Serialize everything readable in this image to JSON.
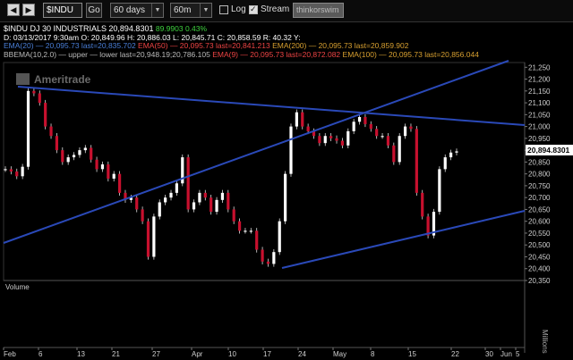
{
  "toolbar": {
    "symbol": "$INDU",
    "go_label": "Go",
    "period_value": "60 days",
    "interval_value": "60m",
    "log_label": "Log",
    "log_checked": false,
    "stream_label": "Stream",
    "stream_checked": true,
    "brand_logo_text": "thinkorswim"
  },
  "header": {
    "line1_name": "$INDU DJ 30 INDUSTRIALS",
    "line1_price": "20,894.8301",
    "line1_change": "89.9903",
    "line1_pct": "0.43%",
    "line2": "D: 03/13/2017    9:30am  O: 20,849.96  H: 20,886.03  L: 20,845.71  C: 20,858.59  R: 40.32    Y:",
    "ema_line": {
      "ema20": "EMA(20) — 20,095.73 last=20,835.702",
      "ema50": "EMA(50) — 20,095.73 last=20,841.213",
      "ema200": "EMA(200) — 20,095.73 last=20,859.902"
    },
    "bb_line": {
      "bb": "BBEMA(10,2.0) — upper — lower last=20,948.19;20,786.105",
      "ema9": "EMA(9) — 20,095.73 last=20,872.082",
      "ema100": "EMA(100) — 20,095.73 last=20,856.044"
    }
  },
  "watermark": "Ameritrade",
  "price_axis": {
    "labels": [
      "21,250",
      "21,200",
      "21,150",
      "21,100",
      "21,050",
      "21,000",
      "20,950",
      "20,900",
      "20,850",
      "20,800",
      "20,750",
      "20,700",
      "20,650",
      "20,600",
      "20,550",
      "20,500",
      "20,450",
      "20,400",
      "20,350"
    ],
    "last_price_label": "20,894.8301"
  },
  "volume_panel": {
    "label": "Volume",
    "unit_label": "Millions"
  },
  "x_axis": {
    "labels": [
      "Feb",
      "6",
      "13",
      "21",
      "27",
      "Apr",
      "10",
      "17",
      "24",
      "May",
      "8",
      "15",
      "22",
      "30",
      "Jun",
      "5"
    ]
  },
  "colors": {
    "background": "#000000",
    "trendline": "#2a49b8",
    "candle": "#ffffff",
    "candle_down": "#c8102e",
    "gain": "#3fd13f",
    "ema20": "#4a7fd8",
    "ema50": "#d33333",
    "ema200": "#d8a030"
  },
  "chart_data": {
    "type": "candlestick",
    "title": "$INDU DJ 30 INDUSTRIALS",
    "interval": "60m",
    "period": "60 days",
    "ylim": [
      20350,
      21270
    ],
    "last_price": 20894.8301,
    "x_labels": [
      "Feb",
      "6",
      "13",
      "21",
      "27",
      "Apr",
      "10",
      "17",
      "24",
      "May",
      "8",
      "15",
      "22",
      "30",
      "Jun",
      "5"
    ],
    "series": [
      {
        "name": "$INDU",
        "values": [
          20820,
          20810,
          20790,
          20830,
          21150,
          21140,
          21100,
          21000,
          20960,
          20900,
          20850,
          20870,
          20880,
          20900,
          20910,
          20860,
          20820,
          20840,
          20780,
          20800,
          20720,
          20690,
          20700,
          20650,
          20600,
          20450,
          20620,
          20680,
          20700,
          20720,
          20760,
          20870,
          20650,
          20680,
          20720,
          20700,
          20640,
          20690,
          20720,
          20650,
          20600,
          20560,
          20560,
          20560,
          20480,
          20430,
          20420,
          20470,
          20600,
          20800,
          21000,
          21060,
          21000,
          20980,
          20960,
          20930,
          20960,
          20950,
          20940,
          20920,
          20980,
          21020,
          21040,
          21010,
          20990,
          20960,
          20960,
          20920,
          20850,
          20960,
          21000,
          20990,
          20720,
          20620,
          20540,
          20640,
          20820,
          20870,
          20890,
          20895
        ]
      }
    ]
  }
}
